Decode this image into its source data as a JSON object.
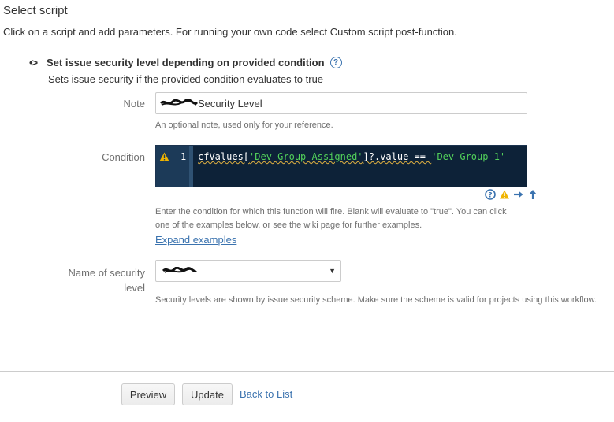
{
  "page": {
    "section_title": "Select script",
    "intro": "Click on a script and add parameters. For running your own code select Custom script post-function."
  },
  "script": {
    "arrow": "•>",
    "title": "Set issue security level depending on provided condition",
    "description": "Sets issue security if the provided condition evaluates to true"
  },
  "note": {
    "label": "Note",
    "value_suffix": "Security Level",
    "hint": "An optional note, used only for your reference."
  },
  "condition": {
    "label": "Condition",
    "line_number": "1",
    "code": {
      "p1": "cfValues[",
      "s1": "'Dev-Group-Assigned'",
      "p2": "]?.value == ",
      "s2": "'Dev-Group-1'"
    },
    "help_line1": "Enter the condition for which this function will fire. Blank will evaluate to \"true\". You can click",
    "help_line2": "one of the examples below, or see the wiki page for further examples.",
    "expand_link": "Expand examples"
  },
  "security": {
    "label_line1": "Name of security",
    "label_line2": "level",
    "hint": "Security levels are shown by issue security scheme. Make sure the scheme is valid for projects using this workflow."
  },
  "actions": {
    "preview": "Preview",
    "update": "Update",
    "back": "Back to List"
  },
  "colors": {
    "link": "#3b73af",
    "editor_bg": "#0d2238",
    "string": "#52d05a",
    "warning": "#f0b400"
  },
  "icons": [
    "help-circle-icon",
    "warning-icon",
    "arrow-right-icon",
    "arrow-up-icon",
    "chevron-down-icon"
  ]
}
